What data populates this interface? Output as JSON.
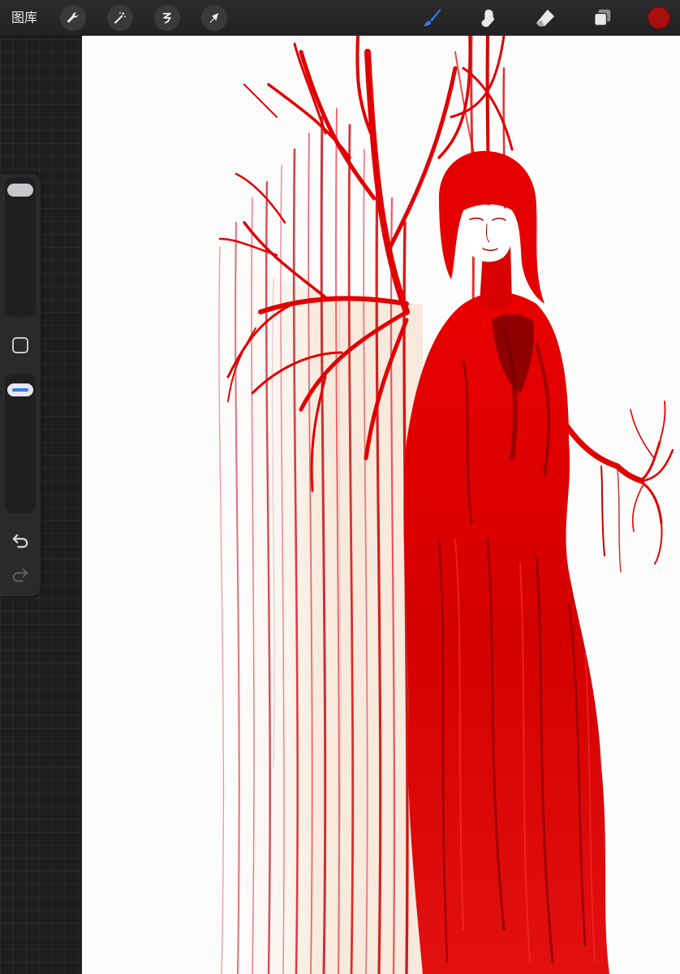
{
  "toolbar": {
    "gallery_label": "图库",
    "left_tools": [
      {
        "icon": "wrench-icon",
        "label": "actions"
      },
      {
        "icon": "magic-wand-icon",
        "label": "adjustments"
      },
      {
        "icon": "selection-icon",
        "label": "selection"
      },
      {
        "icon": "arrow-cursor-icon",
        "label": "transform"
      }
    ],
    "right_tools": [
      {
        "icon": "brush-icon",
        "active": true
      },
      {
        "icon": "smudge-icon",
        "active": false
      },
      {
        "icon": "eraser-icon",
        "active": false
      },
      {
        "icon": "layers-icon",
        "active": false
      }
    ],
    "current_color": "#a80f0f",
    "active_tool_color": "#2f7cf6"
  },
  "sidebar": {
    "brush_size_level": 0.0,
    "opacity_level": 0.0,
    "items": [
      "brush-size-slider",
      "modify-button",
      "opacity-slider",
      "undo-button",
      "redo-button"
    ]
  },
  "canvas": {
    "artwork_colors": [
      "#e00000",
      "#b00000",
      "#7a0000",
      "#f06070"
    ],
    "background": "#fdfcfc"
  }
}
